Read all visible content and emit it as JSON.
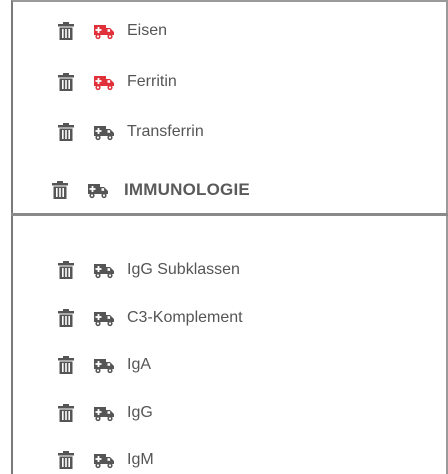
{
  "items_top": [
    {
      "label": "Eisen",
      "truck_color": "#e0303a"
    },
    {
      "label": "Ferritin",
      "truck_color": "#e0303a"
    },
    {
      "label": "Transferrin",
      "truck_color": "#555555"
    }
  ],
  "section_header": {
    "label": "IMMUNOLOGIE",
    "truck_color": "#555555"
  },
  "items_bottom": [
    {
      "label": "IgG Subklassen",
      "truck_color": "#555555"
    },
    {
      "label": "C3-Komplement",
      "truck_color": "#555555"
    },
    {
      "label": "IgA",
      "truck_color": "#555555"
    },
    {
      "label": "IgG",
      "truck_color": "#555555"
    },
    {
      "label": "IgM",
      "truck_color": "#555555"
    }
  ],
  "icons": {
    "delete": "trash-icon",
    "transport": "truck-icon"
  },
  "colors": {
    "icon_gray": "#555555",
    "accent_red": "#e0303a",
    "text": "#555555"
  }
}
